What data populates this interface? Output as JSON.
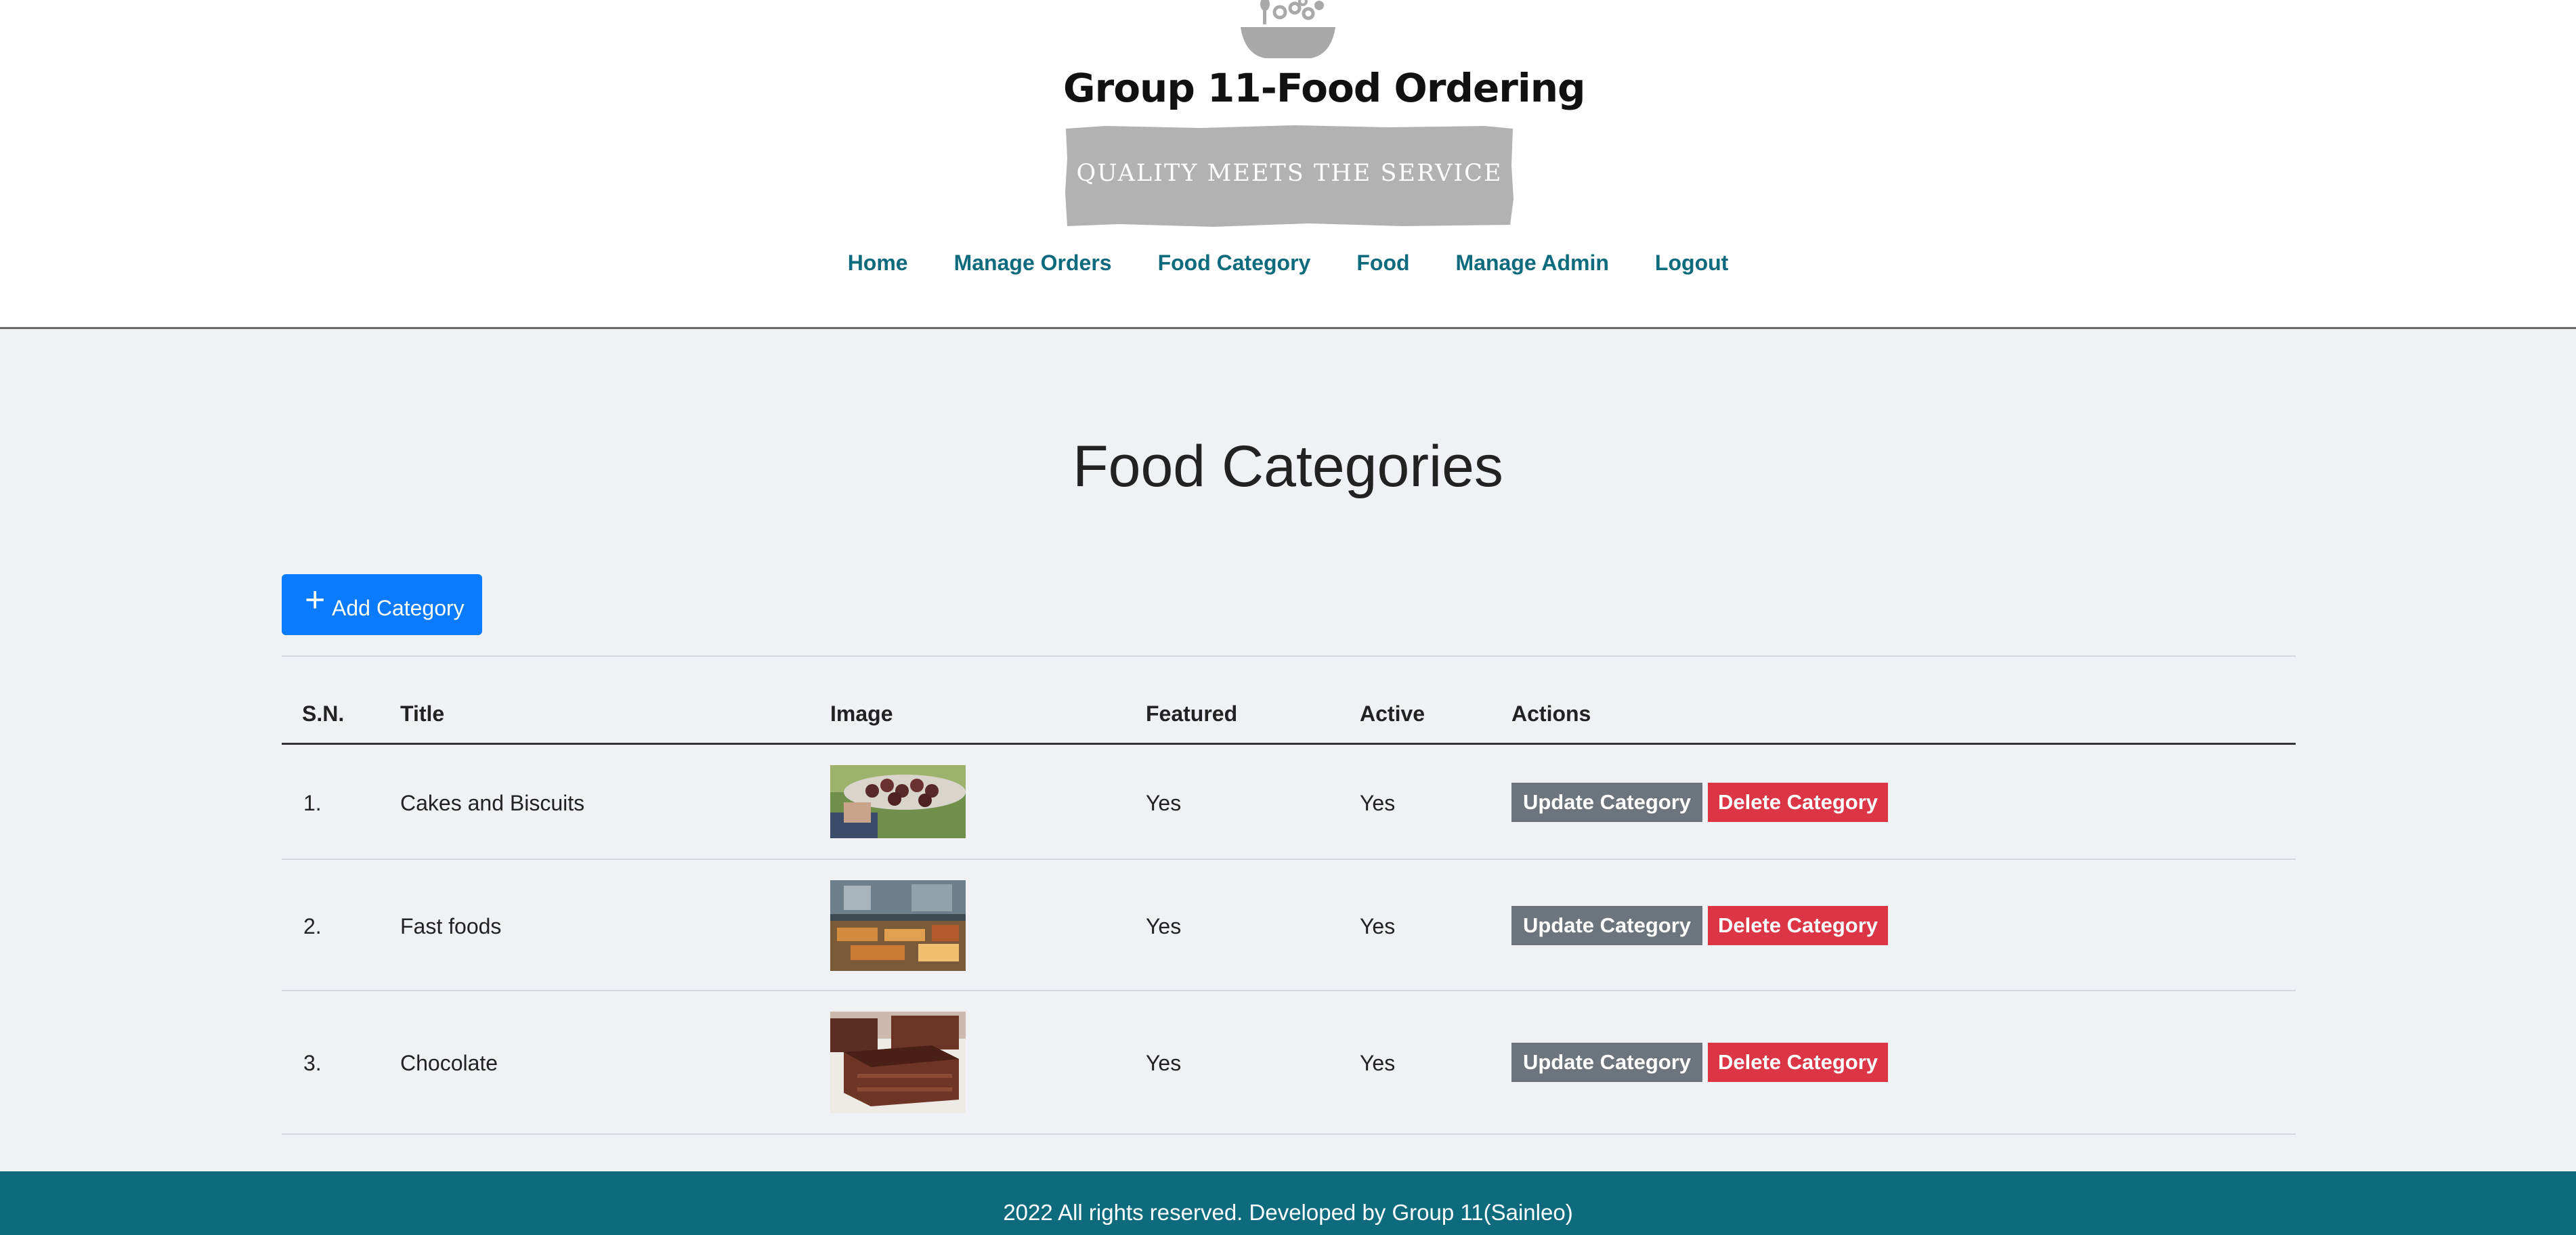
{
  "brand": {
    "name": "Group 11-Food Ordering",
    "tagline": "QUALITY MEETS THE SERVICE",
    "logo_icon": "food-bowl-icon"
  },
  "nav": {
    "items": [
      "Home",
      "Manage Orders",
      "Food Category",
      "Food",
      "Manage Admin",
      "Logout"
    ]
  },
  "page": {
    "title": "Food Categories",
    "add_button": "Add Category",
    "add_icon": "plus-icon"
  },
  "table": {
    "headers": [
      "S.N.",
      "Title",
      "Image",
      "Featured",
      "Active",
      "Actions"
    ],
    "rows": [
      {
        "sn": "1.",
        "title": "Cakes and Biscuits",
        "image": "cupcakes-tray-thumbnail",
        "featured": "Yes",
        "active": "Yes",
        "update": "Update Category",
        "delete": "Delete Category"
      },
      {
        "sn": "2.",
        "title": "Fast foods",
        "image": "fast-food-counter-thumbnail",
        "featured": "Yes",
        "active": "Yes",
        "update": "Update Category",
        "delete": "Delete Category"
      },
      {
        "sn": "3.",
        "title": "Chocolate",
        "image": "chocolate-cake-thumbnail",
        "featured": "Yes",
        "active": "Yes",
        "update": "Update Category",
        "delete": "Delete Category"
      }
    ]
  },
  "footer": {
    "text": "2022 All rights reserved. Developed by Group 11(Sainleo)"
  },
  "colors": {
    "nav_link": "#0e6b7d",
    "footer_bg": "#0e6b7d",
    "primary": "#0a7bff",
    "secondary": "#6c757d",
    "danger": "#dc3545",
    "page_bg": "#f0f1f5"
  }
}
